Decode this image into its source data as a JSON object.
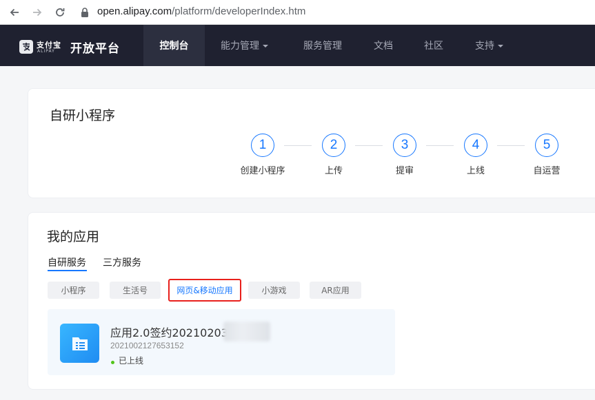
{
  "browser": {
    "url_host": "open.alipay.com",
    "url_path": "/platform/developerIndex.htm"
  },
  "topnav": {
    "logo_cn": "支付宝",
    "logo_en": "ALIPAY",
    "platform_name": "开放平台",
    "items": [
      {
        "label": "控制台",
        "active": true
      },
      {
        "label": "能力管理",
        "dropdown": true
      },
      {
        "label": "服务管理"
      },
      {
        "label": "文档"
      },
      {
        "label": "社区"
      },
      {
        "label": "支持",
        "dropdown": true
      }
    ]
  },
  "steps_card": {
    "title": "自研小程序",
    "steps": [
      {
        "number": "1",
        "label": "创建小程序"
      },
      {
        "number": "2",
        "label": "上传"
      },
      {
        "number": "3",
        "label": "提审"
      },
      {
        "number": "4",
        "label": "上线"
      },
      {
        "number": "5",
        "label": "自运营"
      }
    ]
  },
  "apps_card": {
    "title": "我的应用",
    "tabs": [
      {
        "label": "自研服务",
        "active": true
      },
      {
        "label": "三方服务"
      }
    ],
    "filters": [
      {
        "label": "小程序"
      },
      {
        "label": "生活号"
      },
      {
        "label": "网页&移动应用",
        "selected": true
      },
      {
        "label": "小游戏"
      },
      {
        "label": "AR应用"
      }
    ],
    "app": {
      "name": "应用2.0签约20210203",
      "id": "2021002127653152",
      "status": "已上线",
      "icon": "document-list-icon"
    }
  },
  "colors": {
    "accent": "#1677ff",
    "nav_bg": "#1f2130",
    "highlight_border": "#e8201c",
    "status_online": "#52c41a"
  }
}
